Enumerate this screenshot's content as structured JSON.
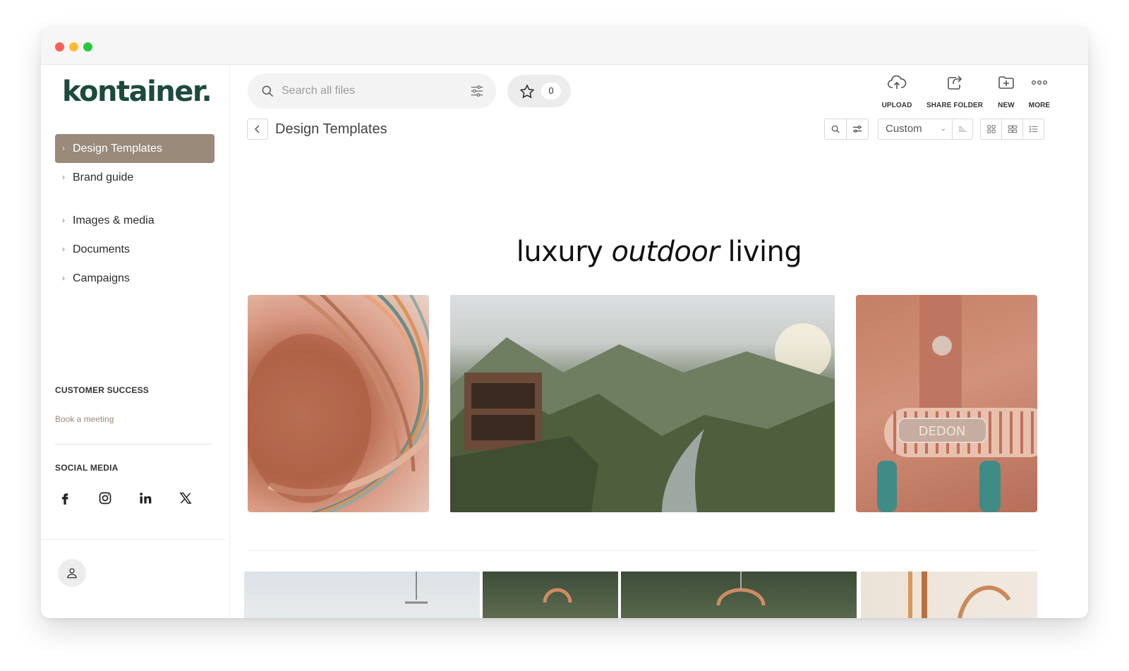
{
  "brand": {
    "logo_text": "kontainer.",
    "accent_color": "#9a8a7a",
    "logo_color": "#1d4a3c"
  },
  "sidebar": {
    "items": [
      {
        "label": "Design Templates",
        "active": true
      },
      {
        "label": "Brand guide",
        "active": false
      },
      {
        "label": "Images & media",
        "active": false
      },
      {
        "label": "Documents",
        "active": false
      },
      {
        "label": "Campaigns",
        "active": false
      }
    ],
    "customer_success_title": "CUSTOMER SUCCESS",
    "book_meeting_label": "Book a meeting",
    "social_media_title": "SOCIAL MEDIA",
    "social_icons": [
      "facebook-icon",
      "instagram-icon",
      "linkedin-icon",
      "x-icon"
    ]
  },
  "search": {
    "placeholder": "Search all files"
  },
  "favorites": {
    "count": "0"
  },
  "toolbar": {
    "upload_label": "UPLOAD",
    "share_folder_label": "SHARE FOLDER",
    "new_label": "NEW",
    "more_label": "MORE"
  },
  "breadcrumb": {
    "title": "Design Templates"
  },
  "view_controls": {
    "sort_value": "Custom"
  },
  "content": {
    "headline_before": "luxury ",
    "headline_italic": "outdoor",
    "headline_after": " living",
    "stamp_text": "DEDON"
  }
}
